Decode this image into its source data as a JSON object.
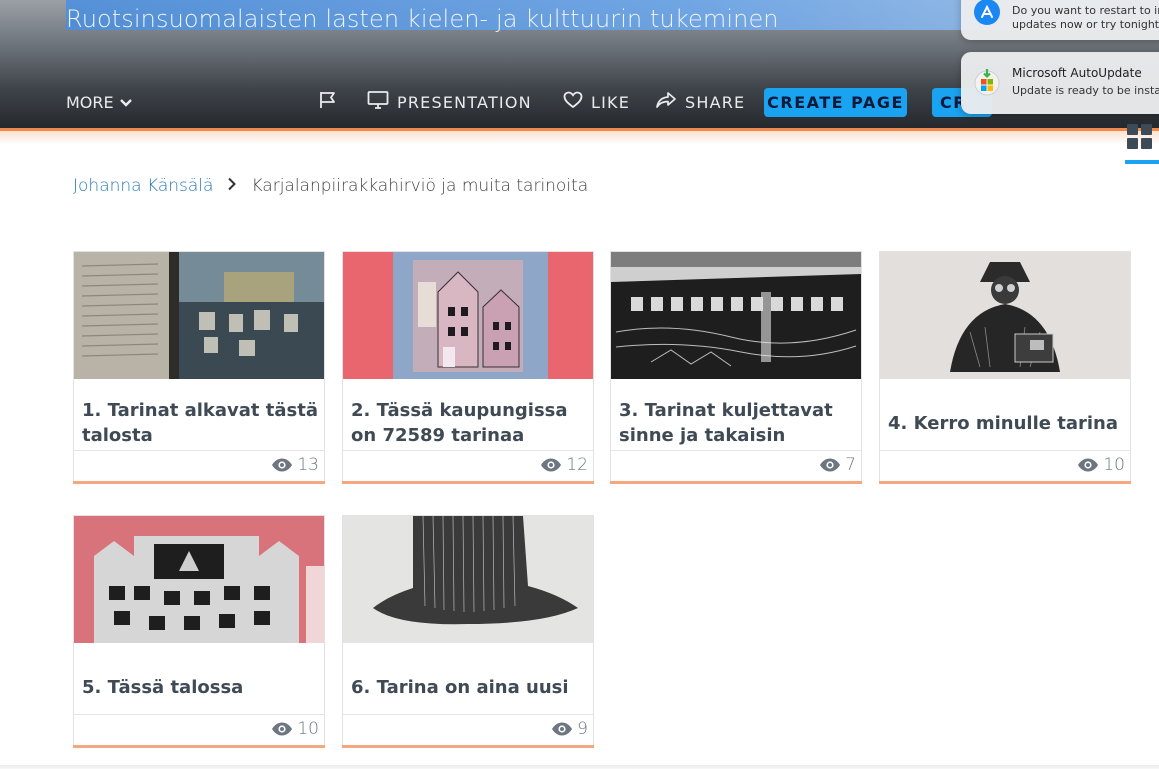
{
  "header": {
    "title": "Ruotsinsuomalaisten lasten kielen- ja kulttuurin tukeminen",
    "more_label": "MORE",
    "presentation_label": "PRESENTATION",
    "like_label": "LIKE",
    "share_label": "SHARE",
    "create_page_label": "CREATE PAGE",
    "create_partial_label": "CR"
  },
  "notifications": [
    {
      "app": "App Store",
      "line1": "Do you want to restart to ins",
      "line2": "updates now or try tonight?"
    },
    {
      "app": "Microsoft AutoUpdate",
      "title": "Microsoft AutoUpdate",
      "body": "Update is ready to be install"
    }
  ],
  "breadcrumb": {
    "parent": "Johanna Känsälä",
    "separator": ">",
    "current": "Karjalanpiirakkahirviö ja muita tarinoita"
  },
  "cards": [
    {
      "title": "1. Tarinat alkavat tästä talosta",
      "views": "13"
    },
    {
      "title": "2. Tässä kaupungissa on 72589 tarinaa",
      "views": "12"
    },
    {
      "title": "3. Tarinat kuljettavat sinne ja takaisin",
      "views": "7"
    },
    {
      "title": "4. Kerro minulle tarina",
      "views": "10"
    },
    {
      "title": "5. Tässä talossa",
      "views": "10"
    },
    {
      "title": "6. Tarina on aina uusi",
      "views": "9"
    }
  ],
  "colors": {
    "accent": "#1aa3f0",
    "header_underline": "#f08a4b",
    "card_bottom": "#f5a87e",
    "breadcrumb_link": "#2a79b5"
  }
}
